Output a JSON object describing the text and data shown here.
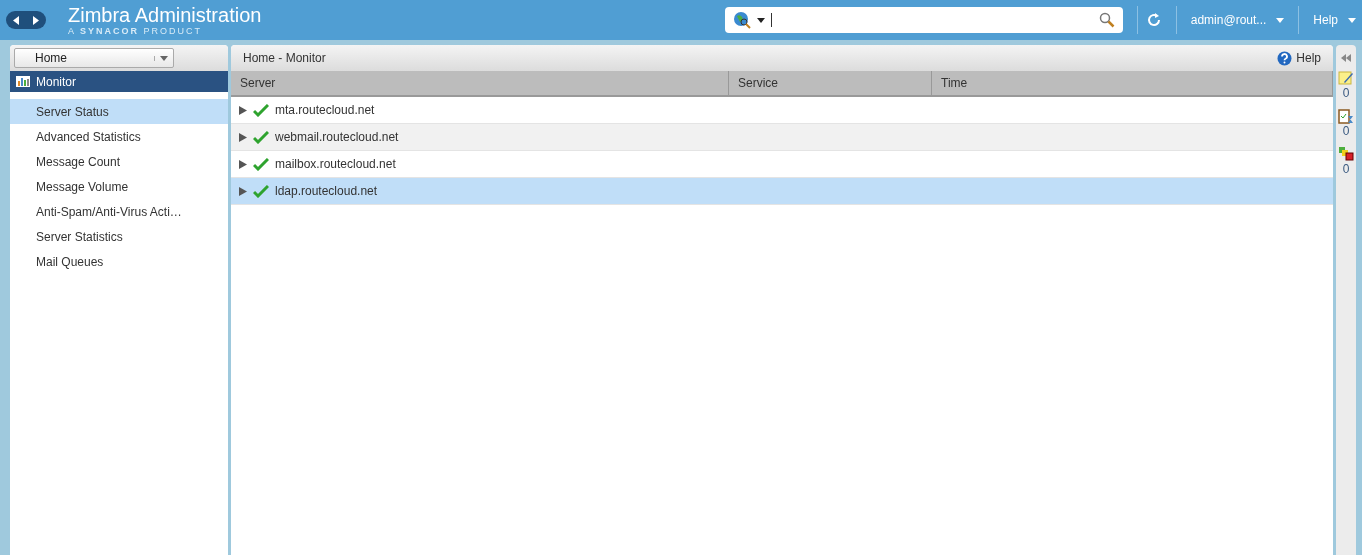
{
  "header": {
    "title": "Zimbra Administration",
    "subtitle_prefix": "A",
    "subtitle_brand": "SYNACOR",
    "subtitle_suffix": "PRODUCT",
    "user": "admin@rout...",
    "help": "Help"
  },
  "sidebar": {
    "breadcrumb": "Home",
    "section": "Monitor",
    "items": [
      {
        "label": "Server Status",
        "selected": true
      },
      {
        "label": "Advanced Statistics",
        "selected": false
      },
      {
        "label": "Message Count",
        "selected": false
      },
      {
        "label": "Message Volume",
        "selected": false
      },
      {
        "label": "Anti-Spam/Anti-Virus Acti…",
        "selected": false
      },
      {
        "label": "Server Statistics",
        "selected": false
      },
      {
        "label": "Mail Queues",
        "selected": false
      }
    ]
  },
  "main": {
    "title": "Home - Monitor",
    "help": "Help",
    "columns": [
      "Server",
      "Service",
      "Time"
    ],
    "rows": [
      {
        "server": "mta.routecloud.net",
        "selected": false
      },
      {
        "server": "webmail.routecloud.net",
        "selected": false
      },
      {
        "server": "mailbox.routecloud.net",
        "selected": false
      },
      {
        "server": "ldap.routecloud.net",
        "selected": true
      }
    ]
  },
  "side_counts": [
    {
      "kind": "notes",
      "count": "0"
    },
    {
      "kind": "tasks",
      "count": "0"
    },
    {
      "kind": "alerts",
      "count": "0"
    }
  ]
}
